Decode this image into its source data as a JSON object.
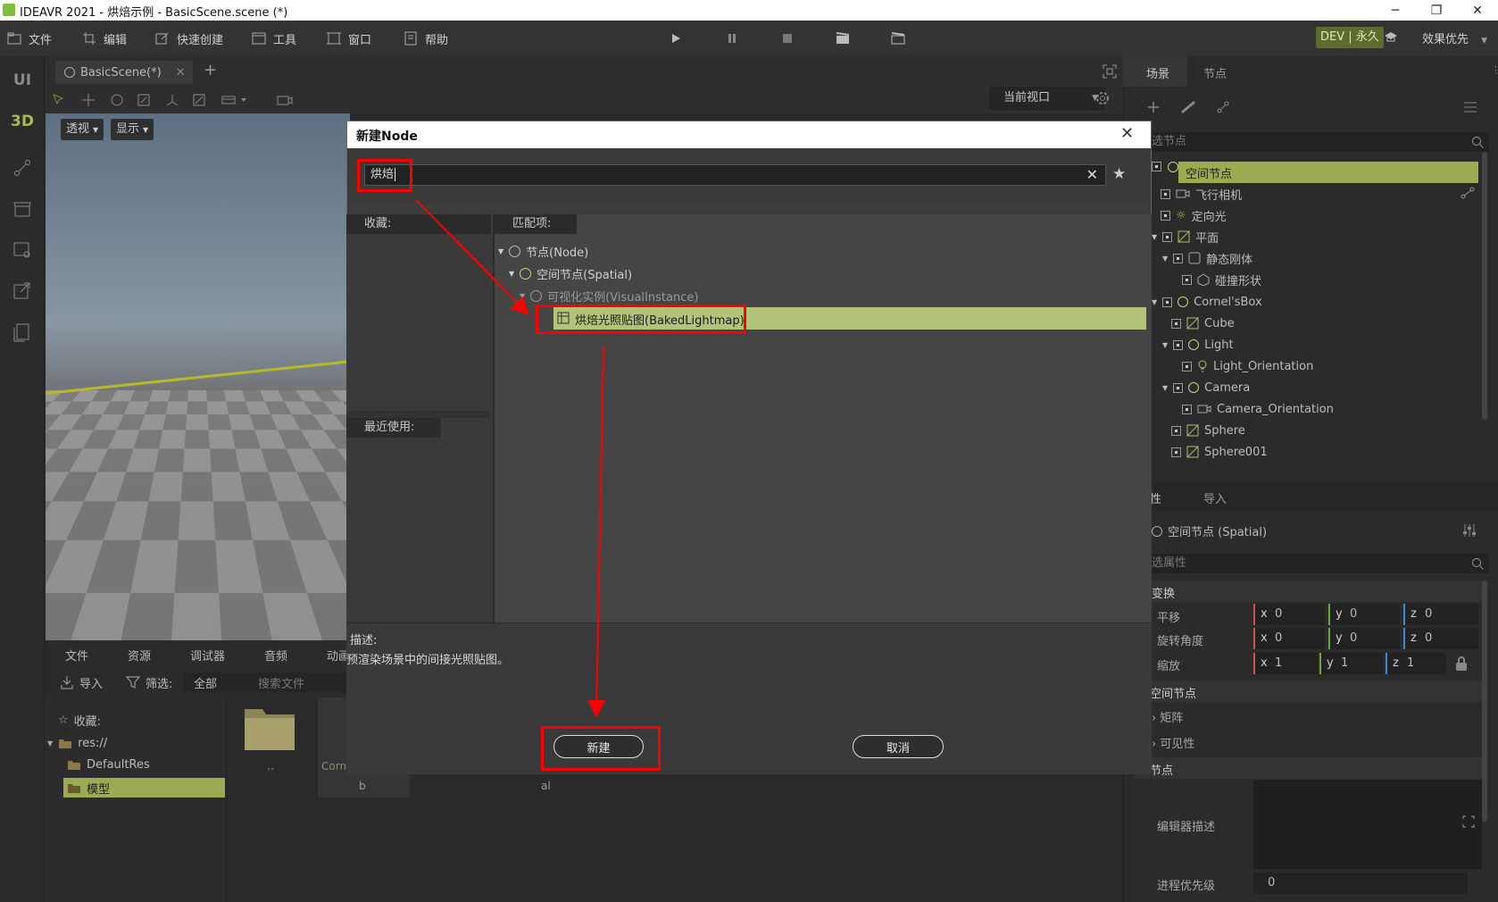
{
  "window": {
    "title": "IDEAVR 2021 - 烘焙示例 - BasicScene.scene (*)",
    "minimize": "─",
    "restore": "❐",
    "close": "✕"
  },
  "menu": {
    "items": [
      "文件",
      "编辑",
      "快速创建",
      "工具",
      "窗口",
      "帮助"
    ],
    "license_badge": "DEV | 永久",
    "render_mode": "效果优先"
  },
  "left_sidebar": {
    "items": [
      "UI",
      "3D"
    ]
  },
  "editor": {
    "scene_tab": "BasicScene(*)",
    "add_tab": "+",
    "viewport_select": "当前视口",
    "perspective_button": "透视",
    "display_button": "显示"
  },
  "bottom_panel": {
    "tabs": [
      "文件",
      "资源",
      "调试器",
      "音频",
      "动画"
    ],
    "import_label": "导入",
    "filter_label": "筛选:",
    "filter_value": "全部",
    "search_placeholder": "搜索文件",
    "tree": {
      "favorites": "收藏:",
      "root": "res://",
      "items": [
        "DefaultRes",
        "模型"
      ]
    },
    "files": [
      "..",
      "Corn",
      "b",
      "al"
    ]
  },
  "scene_panel": {
    "tabs": [
      "场景",
      "节点"
    ],
    "filter_placeholder": "选节点",
    "nodes": [
      "空间节点",
      "飞行相机",
      "定向光",
      "平面",
      "静态刚体",
      "碰撞形状",
      "Cornel'sBox",
      "Cube",
      "Light",
      "Light_Orientation",
      "Camera",
      "Camera_Orientation",
      "Sphere",
      "Sphere001"
    ]
  },
  "inspector": {
    "tabs": [
      "性",
      "导入"
    ],
    "node_label": "空间节点 (Spatial)",
    "filter_placeholder": "选属性",
    "section_transform": "变换",
    "translation_label": "平移",
    "rotation_label": "旋转角度",
    "scale_label": "缩放",
    "translation": {
      "x": "0",
      "y": "0",
      "z": "0"
    },
    "rotation": {
      "x": "0",
      "y": "0",
      "z": "0"
    },
    "scale": {
      "x": "1",
      "y": "1",
      "z": "1"
    },
    "axis_x": "x",
    "axis_y": "y",
    "axis_z": "z",
    "section_spatial": "空间节点",
    "matrix": "矩阵",
    "visibility": "可见性",
    "section_node": "节点",
    "editor_desc": "编辑器描述",
    "process_priority_label": "进程优先级",
    "process_priority": "0"
  },
  "dialog": {
    "title": "新建Node",
    "search_value": "烘焙",
    "favorites_label": "收藏:",
    "recent_label": "最近使用:",
    "matches_label": "匹配项:",
    "tree": [
      "节点(Node)",
      "空间节点(Spatial)",
      "可视化实例(VisualInstance)",
      "烘焙光照贴图(BakedLightmap)"
    ],
    "description_label": "描述:",
    "description": "预渲染场景中的间接光照贴图。",
    "create_button": "新建",
    "cancel_button": "取消"
  },
  "colors": {
    "accent": "#9aab52",
    "selection": "#b3c47a",
    "annotation": "#ff0000"
  }
}
